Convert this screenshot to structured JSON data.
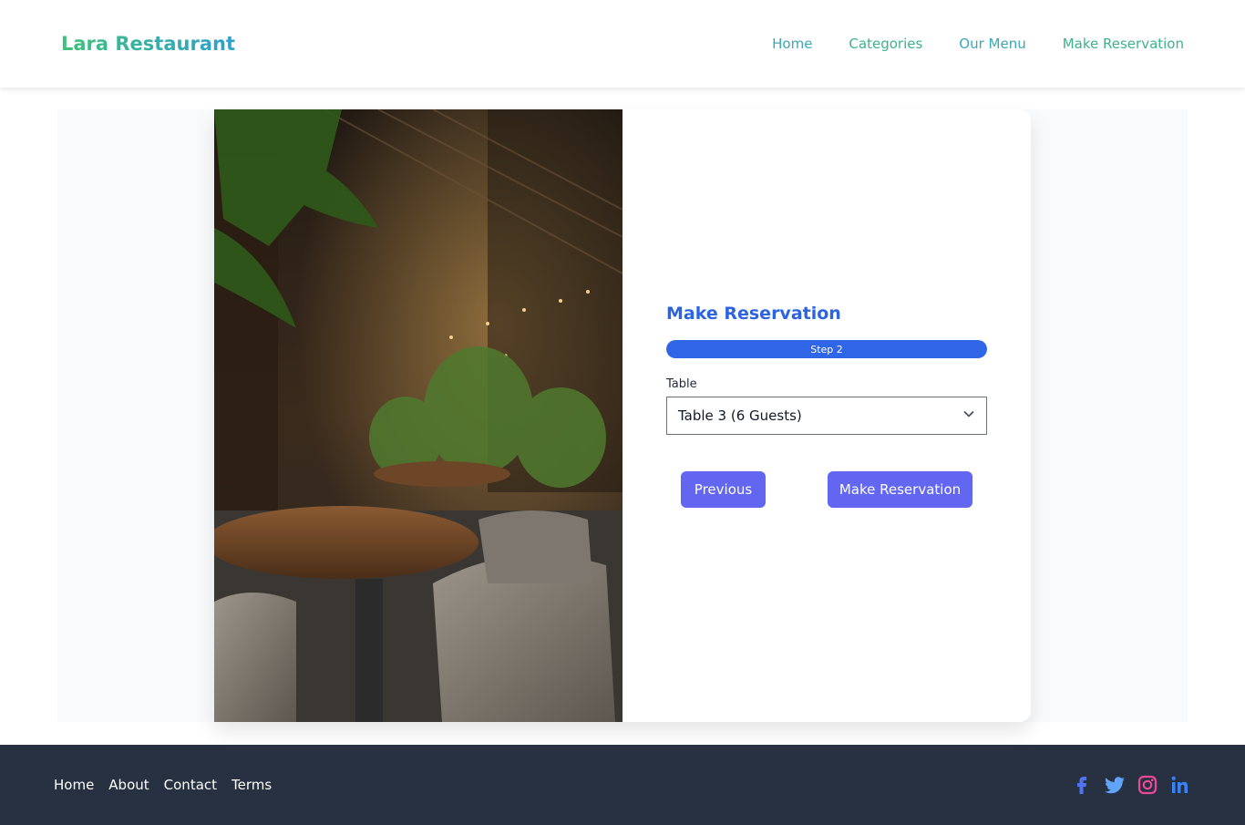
{
  "header": {
    "brand": "Lara Restaurant",
    "nav": [
      {
        "label": "Home",
        "color": "#3aa8b6"
      },
      {
        "label": "Categories",
        "color": "#3cb38a"
      },
      {
        "label": "Our Menu",
        "color": "#3aa8b6"
      },
      {
        "label": "Make Reservation",
        "color": "#3cb38a"
      }
    ]
  },
  "main": {
    "image_alt": "restaurant-interior-photo",
    "form": {
      "title": "Make Reservation",
      "progress": {
        "label": "Step 2",
        "value_percent": 100
      },
      "table_label": "Table",
      "table_selected": "Table 3 (6 Guests)",
      "previous_label": "Previous",
      "submit_label": "Make Reservation"
    }
  },
  "footer": {
    "links": [
      "Home",
      "About",
      "Contact",
      "Terms"
    ],
    "social": [
      {
        "icon": "facebook-icon",
        "color": "#4f72f7"
      },
      {
        "icon": "twitter-icon",
        "color": "#60a5fa"
      },
      {
        "icon": "instagram-icon",
        "color": "#ec4899"
      },
      {
        "icon": "linkedin-icon",
        "color": "#3b82f6"
      }
    ]
  }
}
